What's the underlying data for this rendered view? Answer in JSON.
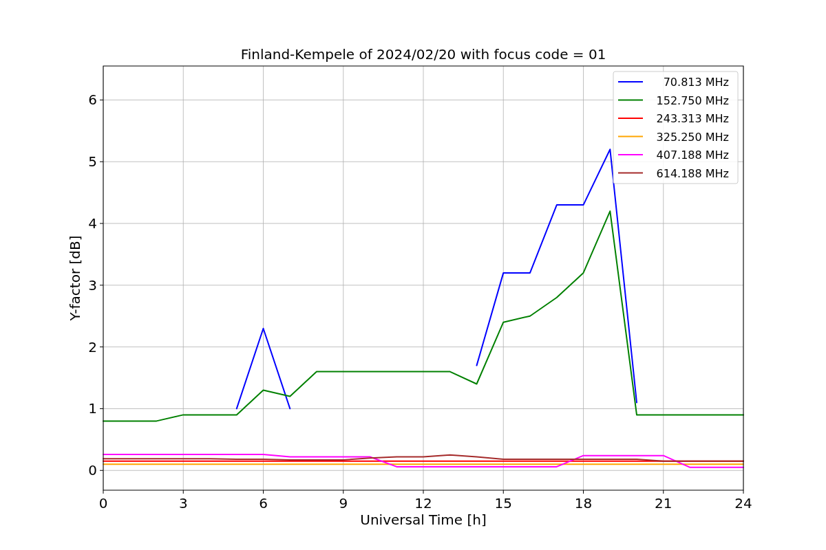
{
  "chart_data": {
    "type": "line",
    "title": "Finland-Kempele of 2024/02/20 with focus code = 01",
    "xlabel": "Universal Time [h]",
    "ylabel": "Y-factor [dB]",
    "x": [
      0,
      1,
      2,
      3,
      4,
      5,
      6,
      7,
      8,
      9,
      10,
      11,
      12,
      13,
      14,
      15,
      16,
      17,
      18,
      19,
      20,
      21,
      22,
      23,
      24
    ],
    "xlim": [
      0,
      24
    ],
    "ylim": [
      -0.32,
      6.55
    ],
    "xticks": [
      0,
      3,
      6,
      9,
      12,
      15,
      18,
      21,
      24
    ],
    "yticks": [
      0,
      1,
      2,
      3,
      4,
      5,
      6
    ],
    "grid": true,
    "legend": true,
    "series": [
      {
        "name": "70.813 MHz",
        "color": "#0000ff",
        "values": [
          null,
          null,
          null,
          null,
          null,
          1.0,
          2.3,
          1.0,
          null,
          null,
          null,
          null,
          null,
          null,
          1.7,
          3.2,
          3.2,
          4.3,
          4.3,
          5.2,
          1.1,
          null,
          null,
          null,
          null
        ]
      },
      {
        "name": "152.750 MHz",
        "color": "#008000",
        "values": [
          0.8,
          0.8,
          0.8,
          0.9,
          0.9,
          0.9,
          1.3,
          1.2,
          1.6,
          1.6,
          1.6,
          1.6,
          1.6,
          1.6,
          1.4,
          2.4,
          2.5,
          2.8,
          3.2,
          4.2,
          0.9,
          0.9,
          0.9,
          0.9,
          0.9
        ]
      },
      {
        "name": "243.313 MHz",
        "color": "#ff0000",
        "values": [
          0.15,
          0.15,
          0.15,
          0.15,
          0.15,
          0.15,
          0.15,
          0.15,
          0.15,
          0.15,
          0.15,
          0.15,
          0.15,
          0.15,
          0.15,
          0.15,
          0.15,
          0.15,
          0.15,
          0.15,
          0.15,
          0.15,
          0.15,
          0.15,
          0.15
        ]
      },
      {
        "name": "325.250 MHz",
        "color": "#ffa500",
        "values": [
          0.1,
          0.1,
          0.1,
          0.1,
          0.1,
          0.1,
          0.1,
          0.1,
          0.1,
          0.1,
          0.1,
          0.1,
          0.1,
          0.1,
          0.1,
          0.1,
          0.1,
          0.1,
          0.1,
          0.1,
          0.1,
          0.1,
          0.1,
          0.1,
          0.1
        ]
      },
      {
        "name": "407.188 MHz",
        "color": "#ff00ff",
        "values": [
          0.26,
          0.26,
          0.26,
          0.26,
          0.26,
          0.26,
          0.26,
          0.22,
          0.22,
          0.22,
          0.22,
          0.06,
          0.06,
          0.06,
          0.06,
          0.06,
          0.06,
          0.06,
          0.24,
          0.24,
          0.24,
          0.24,
          0.05,
          0.05,
          0.05
        ]
      },
      {
        "name": "614.188 MHz",
        "color": "#a52a2a",
        "values": [
          0.19,
          0.19,
          0.19,
          0.19,
          0.19,
          0.18,
          0.18,
          0.17,
          0.17,
          0.17,
          0.2,
          0.22,
          0.22,
          0.25,
          0.22,
          0.18,
          0.18,
          0.18,
          0.18,
          0.18,
          0.18,
          0.15,
          0.15,
          0.15,
          0.15
        ]
      }
    ]
  }
}
